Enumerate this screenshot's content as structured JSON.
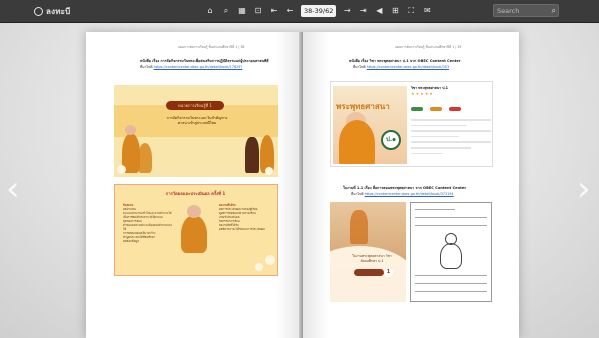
{
  "toolbar": {
    "logo_text": "ลงทะบี",
    "page_indicator": "38-39/62",
    "search_placeholder": "Search",
    "tool_icons": [
      "home-icon",
      "zoom-icon",
      "thumbnails-icon",
      "fit-icon",
      "first-page-icon",
      "prev-page-icon",
      "next-page-icon",
      "last-page-icon",
      "sound-icon",
      "bookmark-icon",
      "fullscreen-icon",
      "email-icon"
    ]
  },
  "left_page": {
    "header": "แผนการจัดการเรียนรู้ ชั้นประถมศึกษาปีที่ 1 | 38",
    "caption": "หนังสือ เรื่อง การจัดกิจกรรมวันพระเพื่อส่งเสริมการปฏิบัติธรรมแก่ผู้ประกอบศาสนพิธี",
    "link_label": "ที่มาไฟล์",
    "link_url": "https://contentcenter.obec.go.th/detail/book/17829?",
    "slide1": {
      "badge": "หน่วยการเรียนรู้ที่ 1",
      "title": "การจัดกิจกรรมวันพระและวันสำคัญทางศาสนาเข้าสู่ประเพณีไทย"
    },
    "slide2": {
      "heading": "การวัดผลและประเมินผล ครั้งที่ 1",
      "left_title": "ข้อตกลง",
      "left_lines": [
        "ผลประเมิน",
        "คะแนนส่วนรวมเข้าใจและถามคำถามได้",
        "เป็นการคิดเห็นวิเคราะห์เป็นระบบ",
        "ชุดของการสอบ",
        "คำตอบแต่ละบทละจะต้องตอบคำถามและให้",
        "การทดสอบย่อยเป็นวงกว้าง",
        "คำพูดประเมินได้ที่สมศึกษา",
        "ทดสอบข้อมูล"
      ],
      "right_title": "ผลงานที่ได้รับ",
      "right_lines": [
        "ผลการประเมินผลงานของผู้เรียน",
        "ดูผลการทดสอบปลายภาคเรียน",
        "เกณฑ์ประเมินผล",
        "กิจกรรมการเรียน",
        "ผลงานสิ่งที่ได้รับ",
        "ผลที่คาดว่าจะได้รับและการประเมินผล"
      ]
    }
  },
  "right_page": {
    "header": "แผนการจัดการเรียนรู้ ชั้นประถมศึกษาปีที่ 1 | 39",
    "caption1": "หนังสือ เรื่อง วิชา พระพุทธศาสนา ป.1 จาก OBEC Content Center",
    "link1_label": "ที่มาไฟล์",
    "link1_url": "https://contentcenter.obec.go.th/detail/book/353",
    "book_cover_text": "พระพุทธศาสนา",
    "book_title": "วิชา พระพุทธศาสนา ป.1",
    "caption2": "ใบงานที่ 1.1 เรื่อง สื่อการสอนพระพุทธศาสนา จาก OBEC Content Center",
    "link2_label": "ที่มาไฟล์",
    "link2_url": "https://contentcenter.obec.go.th/detail/book/373194",
    "worksheet_caption": "ใบงานพระพุทธศาสนา วิชาสังคมศึกษา ป.1",
    "worksheet_number": "1"
  }
}
